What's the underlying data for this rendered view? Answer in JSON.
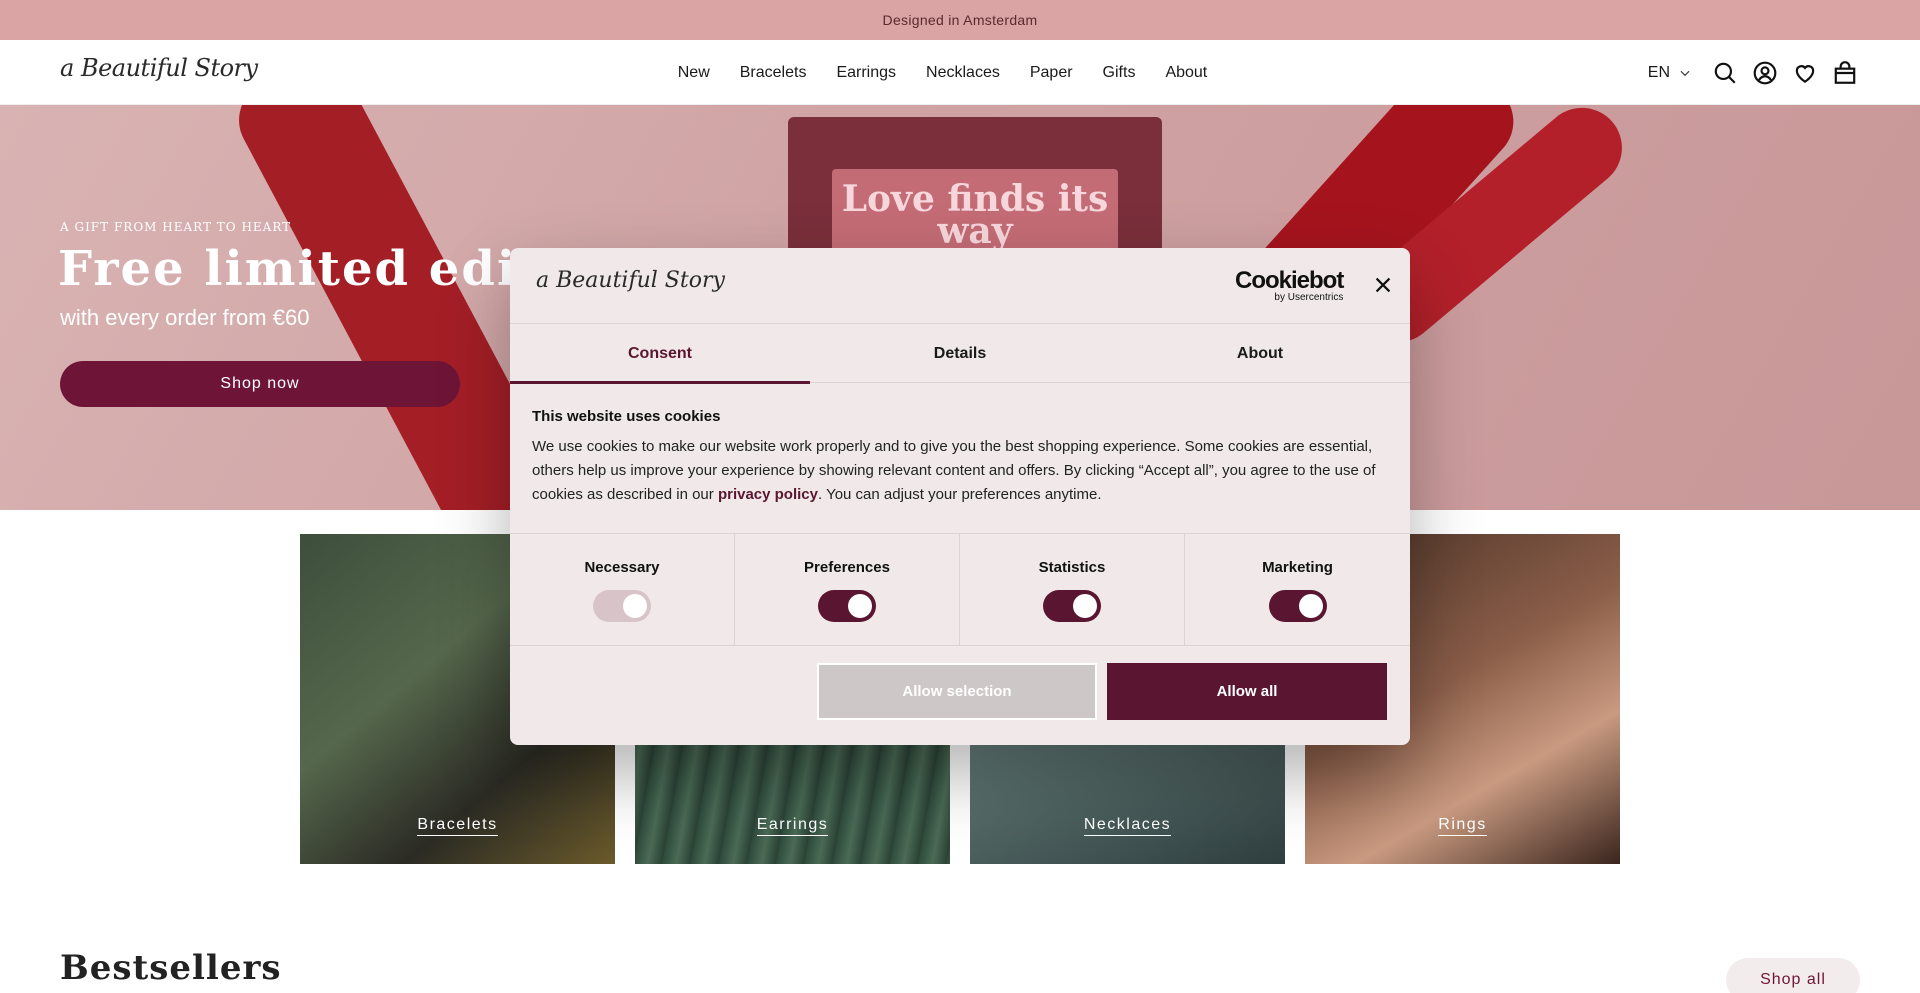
{
  "announcement": "Designed in Amsterdam",
  "header": {
    "logo": "a Beautiful Story",
    "nav": [
      "New",
      "Bracelets",
      "Earrings",
      "Necklaces",
      "Paper",
      "Gifts",
      "About"
    ],
    "language": "EN"
  },
  "hero": {
    "kicker": "A GIFT FROM HEART TO HEART",
    "title": "Free limited edition",
    "subtitle": "with every order from €60",
    "cta": "Shop now",
    "card_text": "Love finds its way"
  },
  "categories": [
    "Bracelets",
    "Earrings",
    "Necklaces",
    "Rings"
  ],
  "bestsellers": {
    "title": "Bestsellers",
    "shop_all": "Shop all"
  },
  "cookie_modal": {
    "logo": "a Beautiful Story",
    "brand": "Cookiebot",
    "brand_sub": "by Usercentrics",
    "tabs": [
      "Consent",
      "Details",
      "About"
    ],
    "active_tab": "Consent",
    "heading": "This website uses cookies",
    "body_before": "We use cookies to make our website work properly and to give you the best shopping experience. Some cookies are essential, others help us improve your experience by showing relevant content and offers. By clicking “Accept all”, you agree to the use of cookies as described in our ",
    "body_link": "privacy policy",
    "body_after": ". You can adjust your preferences anytime.",
    "toggles": [
      {
        "label": "Necessary",
        "on": true,
        "disabled": true
      },
      {
        "label": "Preferences",
        "on": true,
        "disabled": false
      },
      {
        "label": "Statistics",
        "on": true,
        "disabled": false
      },
      {
        "label": "Marketing",
        "on": true,
        "disabled": false
      }
    ],
    "allow_selection": "Allow selection",
    "allow_all": "Allow all"
  },
  "colors": {
    "announcement_bg": "#d9a4a3",
    "brand_plum": "#6e1537",
    "modal_accent": "#5a1630"
  }
}
